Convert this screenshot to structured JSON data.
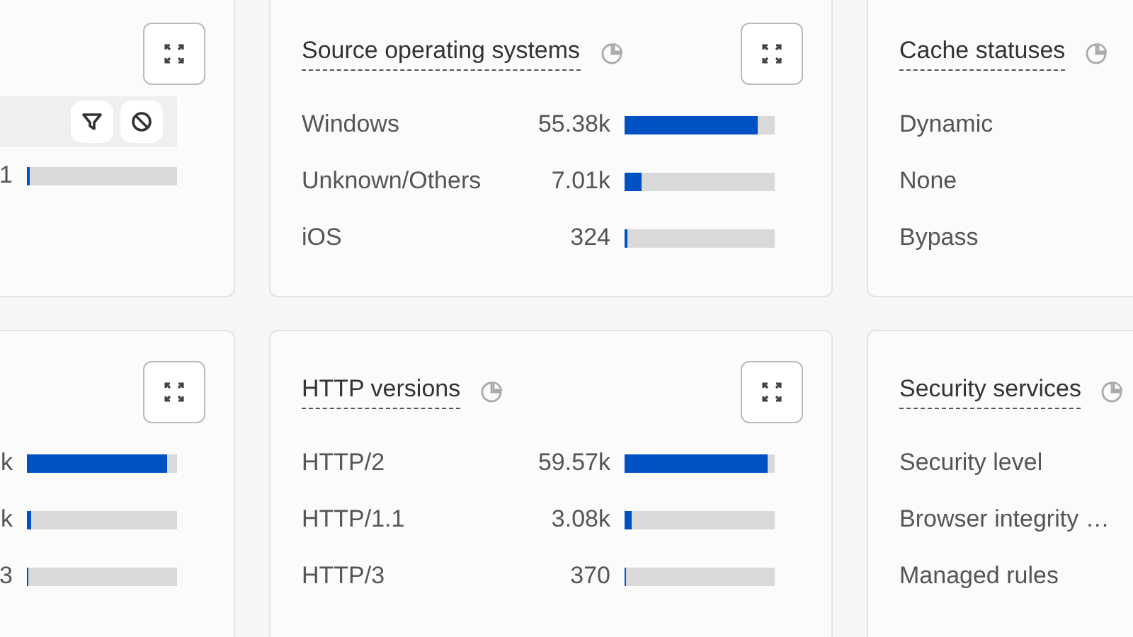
{
  "cards": [
    {
      "rows": [
        {
          "hovered": true
        },
        {
          "hovered": false,
          "value": "1",
          "level": 0.02
        }
      ]
    },
    {
      "title": "Source operating systems",
      "rows": [
        {
          "hovered": false,
          "label": "Windows",
          "value": "55.38k",
          "level": 0.89
        },
        {
          "hovered": false,
          "label": "Unknown/Others",
          "value": "7.01k",
          "level": 0.11
        },
        {
          "hovered": false,
          "label": "iOS",
          "value": "324",
          "level": 0.02
        }
      ]
    },
    {
      "title": "Cache statuses",
      "rows": [
        {
          "hovered": false,
          "label": "Dynamic"
        },
        {
          "hovered": false,
          "label": "None"
        },
        {
          "hovered": false,
          "label": "Bypass"
        }
      ]
    },
    {
      "rows": [
        {
          "hovered": false,
          "value": "k",
          "level": 0.93
        },
        {
          "hovered": false,
          "value": "k",
          "level": 0.03
        },
        {
          "hovered": false,
          "value": "3",
          "level": 0.01
        }
      ]
    },
    {
      "title": "HTTP versions",
      "rows": [
        {
          "hovered": false,
          "label": "HTTP/2",
          "value": "59.57k",
          "level": 0.95
        },
        {
          "hovered": false,
          "label": "HTTP/1.1",
          "value": "3.08k",
          "level": 0.05
        },
        {
          "hovered": false,
          "label": "HTTP/3",
          "value": "370",
          "level": 0.01
        }
      ]
    },
    {
      "title": "Security services",
      "rows": [
        {
          "hovered": false,
          "label": "Security level"
        },
        {
          "hovered": false,
          "label": "Browser integrity …"
        },
        {
          "hovered": false,
          "label": "Managed rules"
        }
      ]
    }
  ]
}
